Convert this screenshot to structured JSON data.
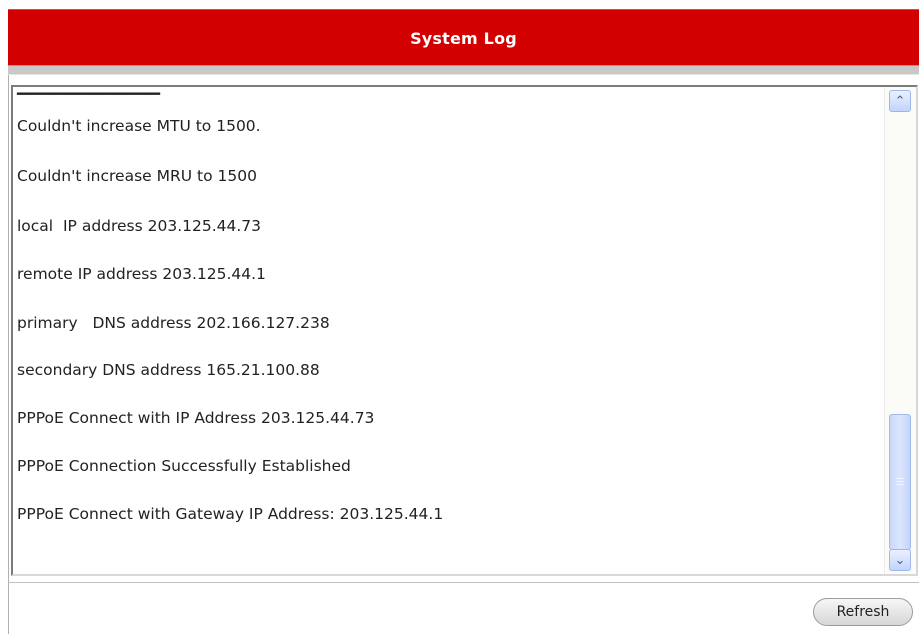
{
  "title": "System Log",
  "log": {
    "lines": [
      "Couldn't increase MTU to 1500.",
      "Couldn't increase MRU to 1500",
      "local  IP address 203.125.44.73",
      "remote IP address 203.125.44.1",
      "primary   DNS address 202.166.127.238",
      "secondary DNS address 165.21.100.88",
      "PPPoE Connect with IP Address 203.125.44.73",
      "PPPoE Connection Successfully Established",
      "PPPoE Connect with Gateway IP Address: 203.125.44.1"
    ]
  },
  "scrollbar": {
    "up_icon": "arrow-up-icon",
    "down_icon": "arrow-down-icon",
    "position": 0.85
  },
  "actions": {
    "refresh_label": "Refresh"
  },
  "colors": {
    "title_bar": "#d20000",
    "scroll_accent": "#c3d3fd"
  }
}
